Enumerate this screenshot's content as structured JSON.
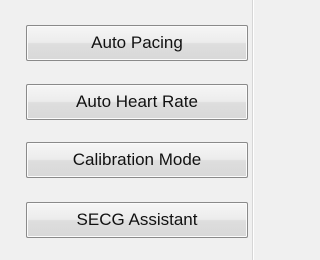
{
  "buttons": [
    {
      "label": "Auto Pacing"
    },
    {
      "label": "Auto Heart Rate"
    },
    {
      "label": "Calibration Mode"
    },
    {
      "label": "SECG Assistant"
    }
  ]
}
